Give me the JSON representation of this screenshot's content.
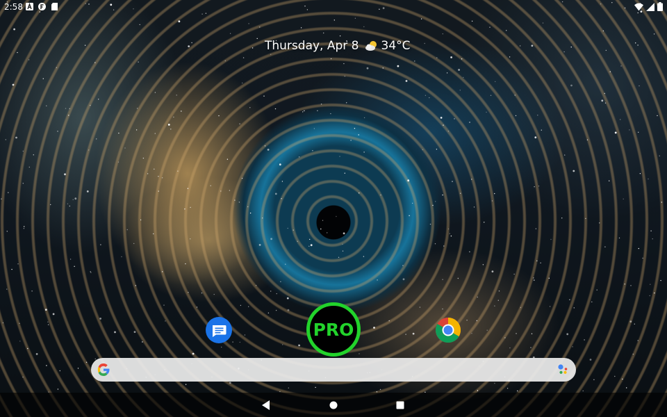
{
  "status_bar": {
    "time": "2:58",
    "left_icons": [
      "app-a-notification-icon",
      "app-f-notification-icon",
      "sd-card-icon"
    ],
    "right_icons": [
      "wifi-icon",
      "signal-icon",
      "battery-icon"
    ]
  },
  "date_widget": {
    "date": "Thursday, Apr 8",
    "weather_icon": "partly-cloudy-icon",
    "temperature": "34°C"
  },
  "apps": [
    {
      "name": "messages-app",
      "icon": "messages-icon",
      "color": "#1a73e8"
    },
    {
      "name": "pro-app",
      "label": "PRO",
      "color": "#22d32b"
    },
    {
      "name": "chrome-app",
      "icon": "chrome-icon"
    }
  ],
  "search_bar": {
    "left_icon": "google-g-icon",
    "right_icon": "google-assistant-icon"
  },
  "nav_bar": {
    "buttons": [
      "back-icon",
      "home-icon",
      "recents-icon"
    ]
  },
  "colors": {
    "pro_accent": "#22d32b",
    "messages_blue": "#1a73e8",
    "search_bar_bg": "#ececec"
  }
}
